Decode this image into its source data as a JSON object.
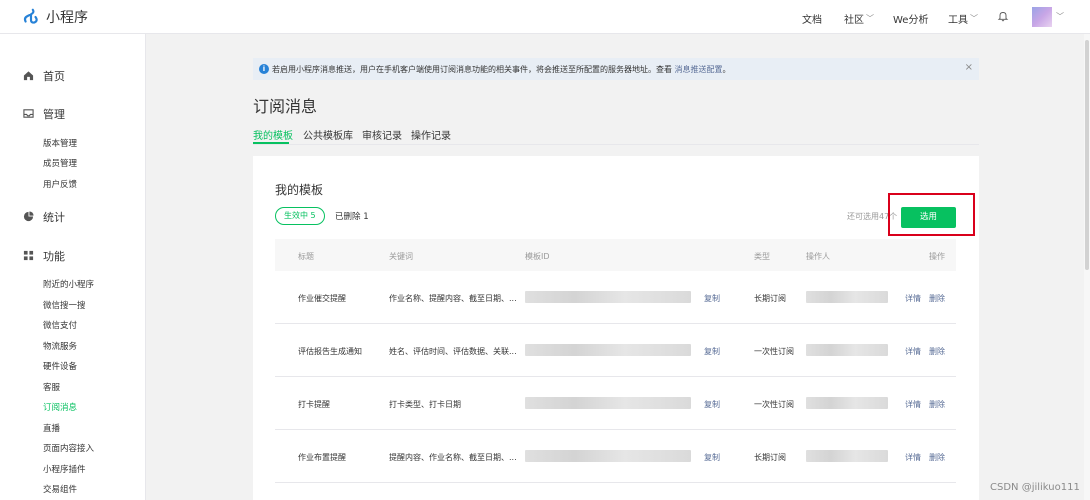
{
  "app": {
    "logo_text": "小程序",
    "brand_color": "#07c160",
    "link_color": "#576b95"
  },
  "topnav": {
    "docs": "文档",
    "community": "社区",
    "analysis": "We分析",
    "tools": "工具"
  },
  "sidebar": {
    "home": "首页",
    "manage": {
      "label": "管理",
      "items": [
        "版本管理",
        "成员管理",
        "用户反馈"
      ]
    },
    "stats": "统计",
    "features": {
      "label": "功能",
      "items": [
        "附近的小程序",
        "微信搜一搜",
        "微信支付",
        "物流服务",
        "硬件设备",
        "客服",
        "订阅消息",
        "直播",
        "页面内容接入",
        "小程序插件",
        "交易组件"
      ]
    },
    "active_item": "订阅消息"
  },
  "notice": {
    "text": "若启用小程序消息推送，用户在手机客户端使用订阅消息功能的相关事件，将会推送至所配置的服务器地址。查看 ",
    "link": "消息推送配置",
    "end": "。",
    "close": "×"
  },
  "page": {
    "title": "订阅消息",
    "tabs": [
      "我的模板",
      "公共模板库",
      "审核记录",
      "操作记录"
    ]
  },
  "card": {
    "title": "我的模板",
    "active_pill": "生效中  5",
    "deleted": "已删除  1",
    "remaining": "还可选用47个",
    "select_button": "选用",
    "columns": [
      "标题",
      "关键词",
      "模板ID",
      "类型",
      "操作人",
      "操作"
    ],
    "rows": [
      {
        "title": "作业催交提醒",
        "keywords": "作业名称、提醒内容、截至日期、...",
        "copy": "复制",
        "type": "长期订阅",
        "detail": "详情",
        "delete": "删除"
      },
      {
        "title": "评估报告生成通知",
        "keywords": "姓名、评估时间、评估数据、关联...",
        "copy": "复制",
        "type": "一次性订阅",
        "detail": "详情",
        "delete": "删除"
      },
      {
        "title": "打卡提醒",
        "keywords": "打卡类型、打卡日期",
        "copy": "复制",
        "type": "一次性订阅",
        "detail": "详情",
        "delete": "删除"
      },
      {
        "title": "作业布置提醒",
        "keywords": "提醒内容、作业名称、截至日期、...",
        "copy": "复制",
        "type": "长期订阅",
        "detail": "详情",
        "delete": "删除"
      }
    ]
  },
  "watermark": "CSDN @jilikuo111"
}
